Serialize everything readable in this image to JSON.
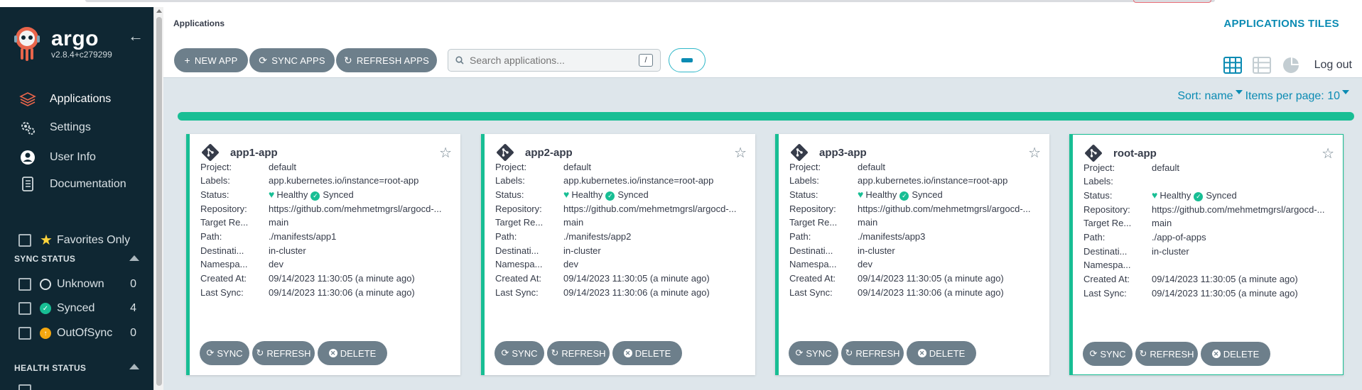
{
  "sidebar": {
    "brand": "argo",
    "version": "v2.8.4+c279299",
    "nav": [
      {
        "label": "Applications",
        "icon": "applications-stack-icon"
      },
      {
        "label": "Settings",
        "icon": "gears-icon"
      },
      {
        "label": "User Info",
        "icon": "user-circle-icon"
      },
      {
        "label": "Documentation",
        "icon": "book-icon"
      }
    ],
    "favorites_label": "Favorites Only",
    "sync_status": {
      "title": "SYNC STATUS",
      "items": [
        {
          "label": "Unknown",
          "count": "0"
        },
        {
          "label": "Synced",
          "count": "4"
        },
        {
          "label": "OutOfSync",
          "count": "0"
        }
      ]
    },
    "health_status": {
      "title": "HEALTH STATUS"
    }
  },
  "header": {
    "breadcrumb": "Applications",
    "title": "APPLICATIONS TILES",
    "new_app": "NEW APP",
    "sync_apps": "SYNC APPS",
    "refresh_apps": "REFRESH APPS",
    "search_placeholder": "Search applications...",
    "search_shortcut": "/",
    "logout": "Log out"
  },
  "content": {
    "sort": "Sort: name",
    "items_per_page": "Items per page: 10"
  },
  "labels": {
    "project": "Project:",
    "labels": "Labels:",
    "status": "Status:",
    "repository": "Repository:",
    "target": "Target Re...",
    "path": "Path:",
    "destination": "Destinati...",
    "namespace": "Namespa...",
    "created": "Created At:",
    "last_sync": "Last Sync:",
    "healthy": "Healthy",
    "synced": "Synced",
    "sync_btn": "SYNC",
    "refresh_btn": "REFRESH",
    "delete_btn": "DELETE"
  },
  "apps": [
    {
      "name": "app1-app",
      "project": "default",
      "labels": "app.kubernetes.io/instance=root-app",
      "repository": "https://github.com/mehmetmgrsl/argocd-...",
      "target": "main",
      "path": "./manifests/app1",
      "destination": "in-cluster",
      "namespace": "dev",
      "created": "09/14/2023 11:30:05  (a minute ago)",
      "last_sync": "09/14/2023 11:30:06  (a minute ago)"
    },
    {
      "name": "app2-app",
      "project": "default",
      "labels": "app.kubernetes.io/instance=root-app",
      "repository": "https://github.com/mehmetmgrsl/argocd-...",
      "target": "main",
      "path": "./manifests/app2",
      "destination": "in-cluster",
      "namespace": "dev",
      "created": "09/14/2023 11:30:05  (a minute ago)",
      "last_sync": "09/14/2023 11:30:06  (a minute ago)"
    },
    {
      "name": "app3-app",
      "project": "default",
      "labels": "app.kubernetes.io/instance=root-app",
      "repository": "https://github.com/mehmetmgrsl/argocd-...",
      "target": "main",
      "path": "./manifests/app3",
      "destination": "in-cluster",
      "namespace": "dev",
      "created": "09/14/2023 11:30:05  (a minute ago)",
      "last_sync": "09/14/2023 11:30:06  (a minute ago)"
    },
    {
      "name": "root-app",
      "project": "default",
      "labels": "",
      "repository": "https://github.com/mehmetmgrsl/argocd-...",
      "target": "main",
      "path": "./app-of-apps",
      "destination": "in-cluster",
      "namespace": "",
      "created": "09/14/2023 11:30:05  (a minute ago)",
      "last_sync": "09/14/2023 11:30:05  (a minute ago)"
    }
  ],
  "colors": {
    "accent": "#0b8bb3",
    "healthy": "#18be94",
    "sidebar": "#0f2733",
    "button": "#6d7f8b",
    "outofsync": "#f4a70f"
  }
}
